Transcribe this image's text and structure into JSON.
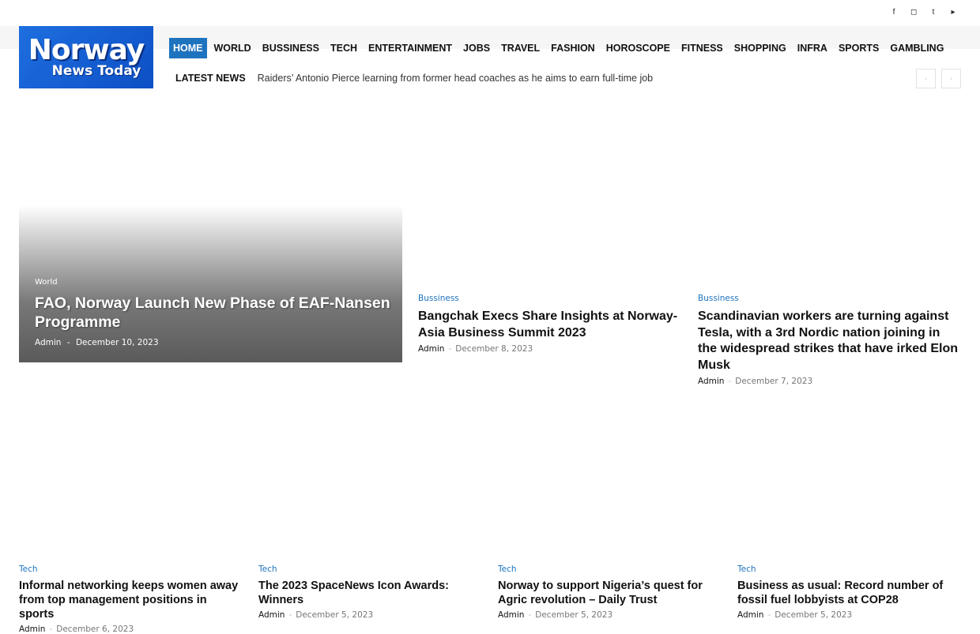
{
  "social_icons": [
    "facebook-icon",
    "instagram-icon",
    "twitter-icon",
    "youtube-icon"
  ],
  "logo": {
    "line1": "Norway",
    "line2": "News Today"
  },
  "nav": [
    {
      "label": "Home",
      "active": true
    },
    {
      "label": "World"
    },
    {
      "label": "Bussiness"
    },
    {
      "label": "Tech"
    },
    {
      "label": "Entertainment"
    },
    {
      "label": "Jobs"
    },
    {
      "label": "Travel"
    },
    {
      "label": "Fashion"
    },
    {
      "label": "Horoscope"
    },
    {
      "label": "Fitness"
    },
    {
      "label": "Shopping"
    },
    {
      "label": "Infra"
    },
    {
      "label": "Sports"
    },
    {
      "label": "Gambling"
    }
  ],
  "ticker": {
    "label": "LATEST NEWS",
    "headline": "Raiders’ Antonio Pierce learning from former head coaches as he aims to earn full-time job"
  },
  "hero": {
    "category": "World",
    "title": "FAO, Norway Launch New Phase of EAF-Nansen Programme",
    "author": "Admin",
    "sep": "-",
    "date": "December 10, 2023"
  },
  "featured": [
    {
      "category": "Bussiness",
      "title": "Bangchak Execs Share Insights at Norway-Asia Business Summit 2023",
      "author": "Admin",
      "sep": "-",
      "date": "December 8, 2023"
    },
    {
      "category": "Bussiness",
      "title": "Scandinavian workers are turning against Tesla, with a 3rd Nordic nation joining in the widespread strikes that have irked Elon Musk",
      "author": "Admin",
      "sep": "-",
      "date": "December 7, 2023"
    }
  ],
  "tech": [
    {
      "category": "Tech",
      "title": "Informal networking keeps women away from top management positions in sports",
      "author": "Admin",
      "sep": "-",
      "date": "December 6, 2023"
    },
    {
      "category": "Tech",
      "title": "The 2023 SpaceNews Icon Awards: Winners",
      "author": "Admin",
      "sep": "-",
      "date": "December 5, 2023"
    },
    {
      "category": "Tech",
      "title": "Norway to support Nigeria’s quest for Agric revolution – Daily Trust",
      "author": "Admin",
      "sep": "-",
      "date": "December 5, 2023"
    },
    {
      "category": "Tech",
      "title": "Business as usual: Record number of fossil fuel lobbyists at COP28",
      "author": "Admin",
      "sep": "-",
      "date": "December 5, 2023"
    }
  ]
}
